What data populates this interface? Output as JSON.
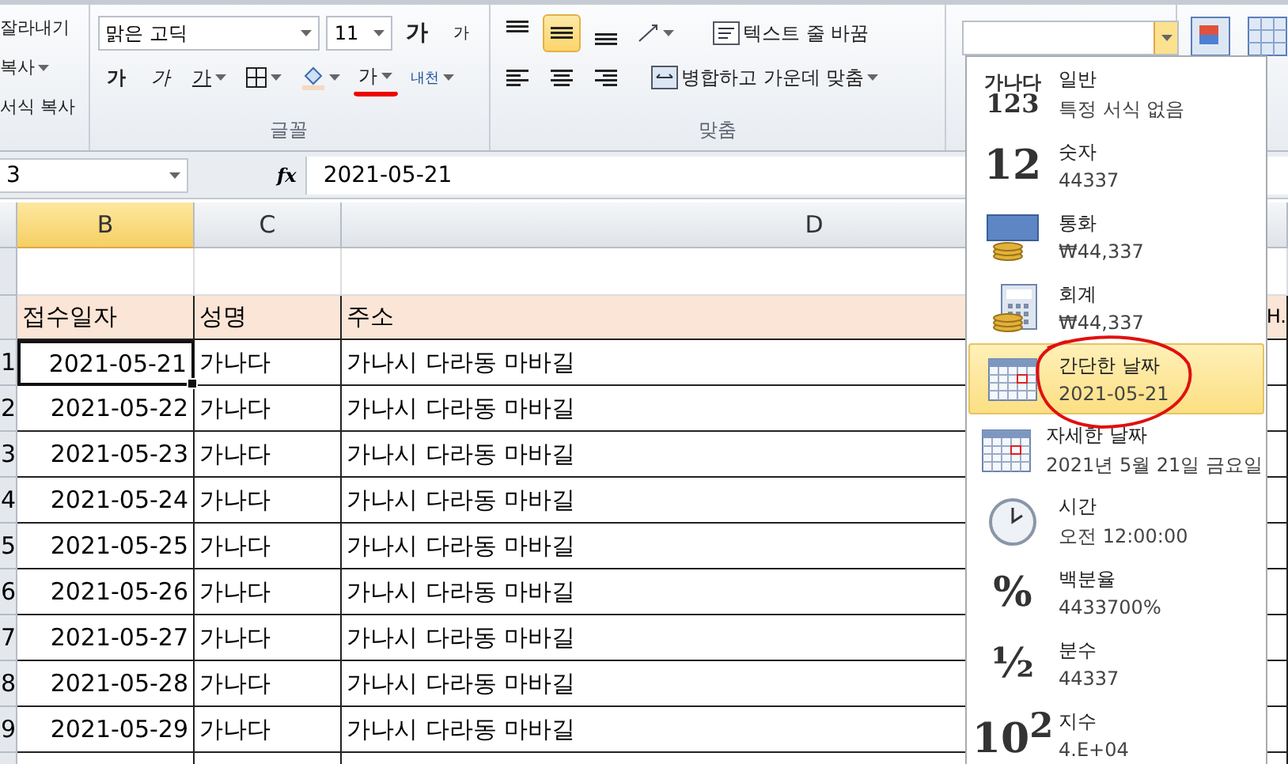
{
  "ribbon": {
    "clipboard": [
      {
        "label": "잘라내기",
        "dropdown": false
      },
      {
        "label": "복사",
        "dropdown": true
      },
      {
        "label": "서식 복사",
        "dropdown": false
      }
    ],
    "font": {
      "font_name": "맑은 고딕",
      "font_size": "11",
      "grow": "가",
      "shrink": "가",
      "bold": "가",
      "italic": "가",
      "underline": "가",
      "font_color": "가",
      "phonetic": "내천",
      "group_label": "글꼴"
    },
    "alignment": {
      "vertical": [
        {
          "selected": false
        },
        {
          "selected": true
        },
        {
          "selected": false
        }
      ],
      "wrap_text": "텍스트 줄 바꿈",
      "merge_center": "병합하고 가운데 맞춤",
      "group_label": "맞춤"
    },
    "number_format": {
      "open": true
    }
  },
  "formula_bar": {
    "name_box": "3",
    "function_label": "fx",
    "formula": "2021-05-21"
  },
  "sheet": {
    "columns": [
      {
        "label": "B",
        "selected": true
      },
      {
        "label": "C",
        "selected": false
      },
      {
        "label": "D",
        "selected": false
      }
    ],
    "header": [
      "접수일자",
      "성명",
      "주소"
    ],
    "header_overflow": "H.",
    "rows": [
      {
        "number": "1",
        "date": "2021-05-21",
        "name": "가나다",
        "address": "가나시 다라동 마바길",
        "active": true
      },
      {
        "number": "2",
        "date": "2021-05-22",
        "name": "가나다",
        "address": "가나시 다라동 마바길",
        "active": false
      },
      {
        "number": "3",
        "date": "2021-05-23",
        "name": "가나다",
        "address": "가나시 다라동 마바길",
        "active": false
      },
      {
        "number": "4",
        "date": "2021-05-24",
        "name": "가나다",
        "address": "가나시 다라동 마바길",
        "active": false
      },
      {
        "number": "5",
        "date": "2021-05-25",
        "name": "가나다",
        "address": "가나시 다라동 마바길",
        "active": false
      },
      {
        "number": "6",
        "date": "2021-05-26",
        "name": "가나다",
        "address": "가나시 다라동 마바길",
        "active": false
      },
      {
        "number": "7",
        "date": "2021-05-27",
        "name": "가나다",
        "address": "가나시 다라동 마바길",
        "active": false
      },
      {
        "number": "8",
        "date": "2021-05-28",
        "name": "가나다",
        "address": "가나시 다라동 마바길",
        "active": false
      },
      {
        "number": "9",
        "date": "2021-05-29",
        "name": "가나다",
        "address": "가나시 다라동 마바길",
        "active": false
      }
    ]
  },
  "format_menu": [
    {
      "kind": "text",
      "icon_text": [
        "가나다",
        "123"
      ],
      "title": "일반",
      "sample": "특정 서식 없음",
      "selected": false
    },
    {
      "kind": "text",
      "icon_text": [
        "12"
      ],
      "title": "숫자",
      "sample": "44337",
      "selected": false
    },
    {
      "kind": "currency",
      "title": "통화",
      "sample": "₩44,337",
      "selected": false
    },
    {
      "kind": "accounting",
      "title": "회계",
      "sample": " ₩44,337",
      "selected": false
    },
    {
      "kind": "calendar",
      "title": "간단한 날짜",
      "sample": "2021-05-21",
      "selected": true
    },
    {
      "kind": "calendar",
      "title": "자세한 날짜",
      "sample": "2021년 5월 21일 금요일",
      "selected": false
    },
    {
      "kind": "clock",
      "title": "시간",
      "sample": "오전 12:00:00",
      "selected": false
    },
    {
      "kind": "text",
      "icon_text": [
        "%"
      ],
      "title": "백분율",
      "sample": "4433700%",
      "selected": false
    },
    {
      "kind": "text",
      "icon_text": [
        "½"
      ],
      "title": "분수",
      "sample": "44337",
      "selected": false
    },
    {
      "kind": "text",
      "icon_text": [
        "10$^{2}$"
      ],
      "title": "지수",
      "sample": "4.E+04",
      "selected": false
    }
  ]
}
